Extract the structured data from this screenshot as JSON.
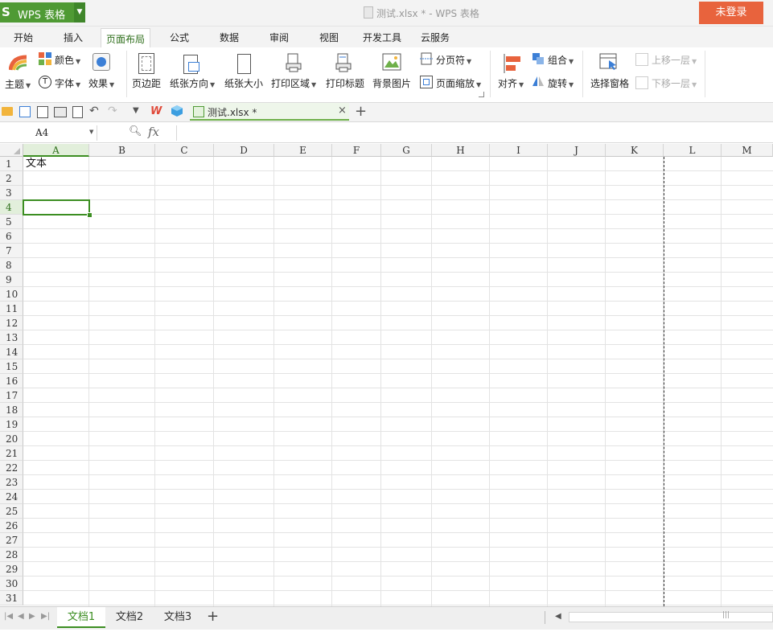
{
  "app": {
    "logo_glyph": "S",
    "name": "WPS 表格",
    "title": "测试.xlsx * - WPS 表格",
    "login_label": "未登录"
  },
  "ribbon_tabs": [
    "开始",
    "插入",
    "页面布局",
    "公式",
    "数据",
    "审阅",
    "视图",
    "开发工具",
    "云服务"
  ],
  "active_tab": "页面布局",
  "ribbon": {
    "theme": "主题",
    "color": "颜色",
    "font": "字体",
    "effect": "效果",
    "margins": "页边距",
    "orientation": "纸张方向",
    "paper_size": "纸张大小",
    "print_area": "打印区域",
    "print_titles": "打印标题",
    "background": "背景图片",
    "page_break": "分页符",
    "page_zoom": "页面缩放",
    "align": "对齐",
    "group": "组合",
    "rotate": "旋转",
    "selection_pane": "选择窗格",
    "bring_forward": "上移一层",
    "send_backward": "下移一层"
  },
  "doc_tab": {
    "label": "测试.xlsx *"
  },
  "formula_bar": {
    "cell_ref": "A4",
    "fx": "fx"
  },
  "columns": [
    "A",
    "B",
    "C",
    "D",
    "E",
    "F",
    "G",
    "H",
    "I",
    "J",
    "K",
    "L",
    "M"
  ],
  "rows": [
    "1",
    "2",
    "3",
    "4",
    "5",
    "6",
    "7",
    "8",
    "9",
    "10",
    "11",
    "12",
    "13",
    "14",
    "15",
    "16",
    "17",
    "18",
    "19",
    "20",
    "21",
    "22",
    "23",
    "24",
    "25",
    "26",
    "27",
    "28",
    "29",
    "30",
    "31"
  ],
  "cells": {
    "A1": "文本"
  },
  "selected_cell": "A4",
  "sheets": [
    "文档1",
    "文档2",
    "文档3"
  ],
  "active_sheet": "文档1",
  "colors": {
    "brand_green": "#4f9a34",
    "login_orange": "#e8633d",
    "selection": "#3c8e22"
  }
}
